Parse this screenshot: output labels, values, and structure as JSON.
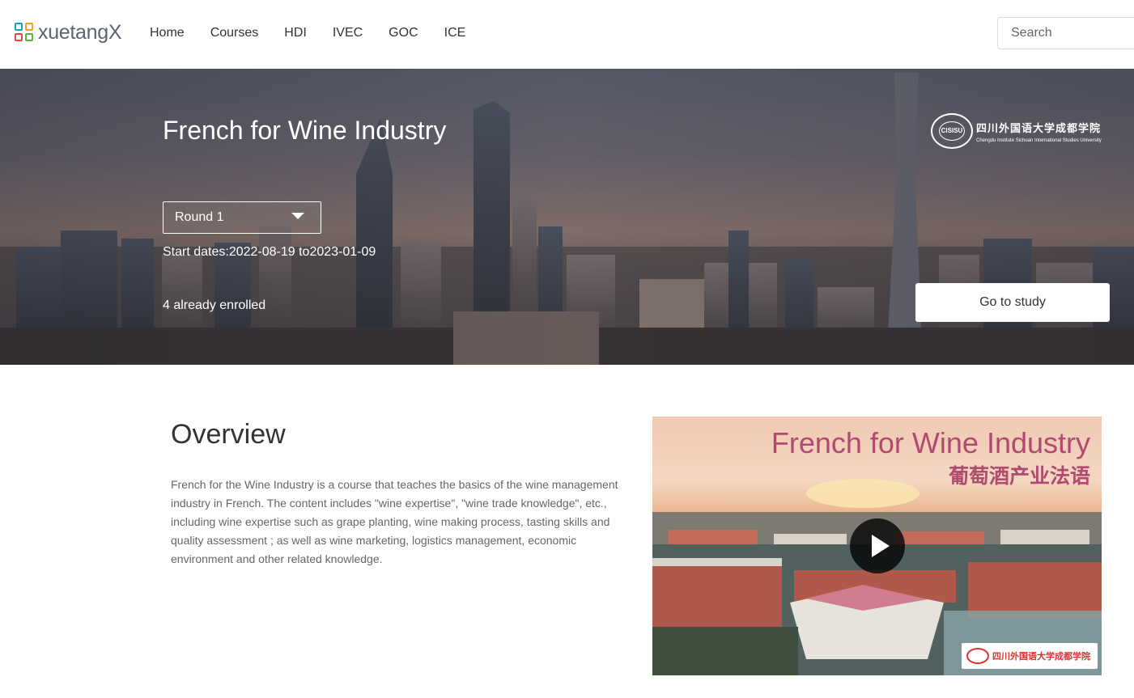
{
  "header": {
    "logo_text": "xuetangX",
    "nav": [
      "Home",
      "Courses",
      "HDI",
      "IVEC",
      "GOC",
      "ICE"
    ],
    "search_placeholder": "Search"
  },
  "hero": {
    "title": "French for Wine Industry",
    "round_selected": "Round 1",
    "dates": "Start dates:2022-08-19 to2023-01-09",
    "enrolled": "4 already enrolled",
    "study_button": "Go to study",
    "university_cn": "四川外国语大学成都学院",
    "university_en": "Chengdu Institute Sichuan International Studies University",
    "seal_abbr": "CISISU"
  },
  "overview": {
    "title": "Overview",
    "body": "French for the Wine Industry is a course that teaches the basics of the wine management industry in French. The content includes \"wine expertise\", \"wine trade knowledge\", etc., including wine expertise such as grape planting, wine making process, tasting skills and quality assessment ; as well as wine marketing, logistics management, economic environment and other related knowledge."
  },
  "video": {
    "title_en": "French for Wine Industry",
    "title_cn": "葡萄酒产业法语",
    "badge_cn": "四川外国语大学成都学院"
  }
}
